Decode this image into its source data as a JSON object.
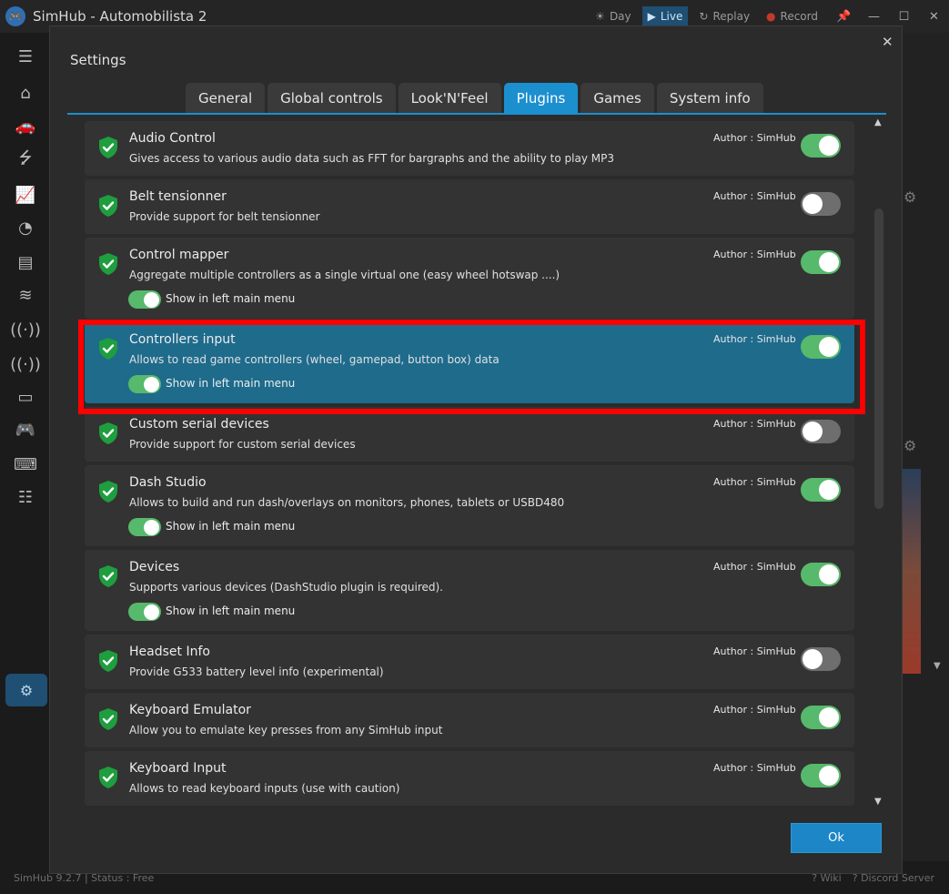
{
  "window": {
    "title": "SimHub - Automobilista 2",
    "day_label": "Day",
    "live_label": "Live",
    "replay_label": "Replay",
    "record_label": "Record"
  },
  "status": {
    "version": "SimHub 9.2.7",
    "status_text": "Status : Free",
    "wiki_label": "? Wiki",
    "discord_label": "? Discord Server"
  },
  "dialog": {
    "title": "Settings",
    "close_glyph": "✕",
    "ok_label": "Ok",
    "tabs": [
      {
        "label": "General",
        "active": false
      },
      {
        "label": "Global controls",
        "active": false
      },
      {
        "label": "Look'N'Feel",
        "active": false
      },
      {
        "label": "Plugins",
        "active": true
      },
      {
        "label": "Games",
        "active": false
      },
      {
        "label": "System info",
        "active": false
      }
    ]
  },
  "plugins": [
    {
      "name": "Audio Control",
      "desc": "Gives access to various audio data such as FFT for bargraphs and the ability to play MP3",
      "author": "Author : SimHub",
      "enabled": true
    },
    {
      "name": "Belt tensionner",
      "desc": "Provide support for belt tensionner",
      "author": "Author : SimHub",
      "enabled": false
    },
    {
      "name": "Control mapper",
      "desc": "Aggregate multiple controllers as a single virtual one (easy wheel hotswap ....)",
      "author": "Author : SimHub",
      "enabled": true,
      "show_in_menu": "Show in left main menu"
    },
    {
      "name": "Controllers input",
      "desc": "Allows to read game controllers (wheel, gamepad, button box) data",
      "author": "Author : SimHub",
      "enabled": true,
      "show_in_menu": "Show in left main menu",
      "selected": true
    },
    {
      "name": "Custom serial devices",
      "desc": "Provide support for custom serial devices",
      "author": "Author : SimHub",
      "enabled": false
    },
    {
      "name": "Dash Studio",
      "desc": "Allows to build and run dash/overlays on monitors, phones, tablets or USBD480",
      "author": "Author : SimHub",
      "enabled": true,
      "show_in_menu": "Show in left main menu"
    },
    {
      "name": "Devices",
      "desc": "Supports various devices (DashStudio plugin is required).",
      "author": "Author : SimHub",
      "enabled": true,
      "show_in_menu": "Show in left main menu"
    },
    {
      "name": "Headset Info",
      "desc": "Provide G533 battery level info (experimental)",
      "author": "Author : SimHub",
      "enabled": false
    },
    {
      "name": "Keyboard Emulator",
      "desc": "Allow you to emulate key presses from any SimHub input",
      "author": "Author : SimHub",
      "enabled": true
    },
    {
      "name": "Keyboard Input",
      "desc": "Allows to read keyboard inputs (use with caution)",
      "author": "Author : SimHub",
      "enabled": true
    }
  ]
}
